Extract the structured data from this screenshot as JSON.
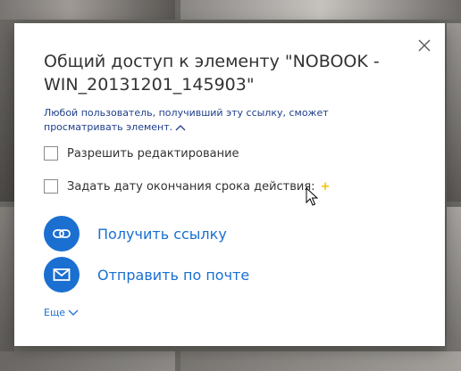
{
  "dialog": {
    "title": "Общий доступ к элементу \"NOBOOK - WIN_20131201_145903\"",
    "close_icon": "close-icon",
    "note_text": "Любой пользователь, получивший эту ссылку, сможет просматривать элемент.",
    "note_collapse_icon": "chevron-up-icon",
    "options": [
      {
        "label": "Разрешить редактирование",
        "checked": false
      },
      {
        "label": "Задать дату окончания срока действия:",
        "checked": false,
        "indicator": "+"
      }
    ],
    "actions": [
      {
        "label": "Получить ссылку",
        "icon": "link-icon"
      },
      {
        "label": "Отправить по почте",
        "icon": "mail-icon"
      }
    ],
    "more_label": "Еще",
    "more_icon": "chevron-down-icon"
  },
  "colors": {
    "accent": "#1a6fd1",
    "note": "#1f3e8a",
    "plus": "#f2c200",
    "text": "#333333"
  }
}
